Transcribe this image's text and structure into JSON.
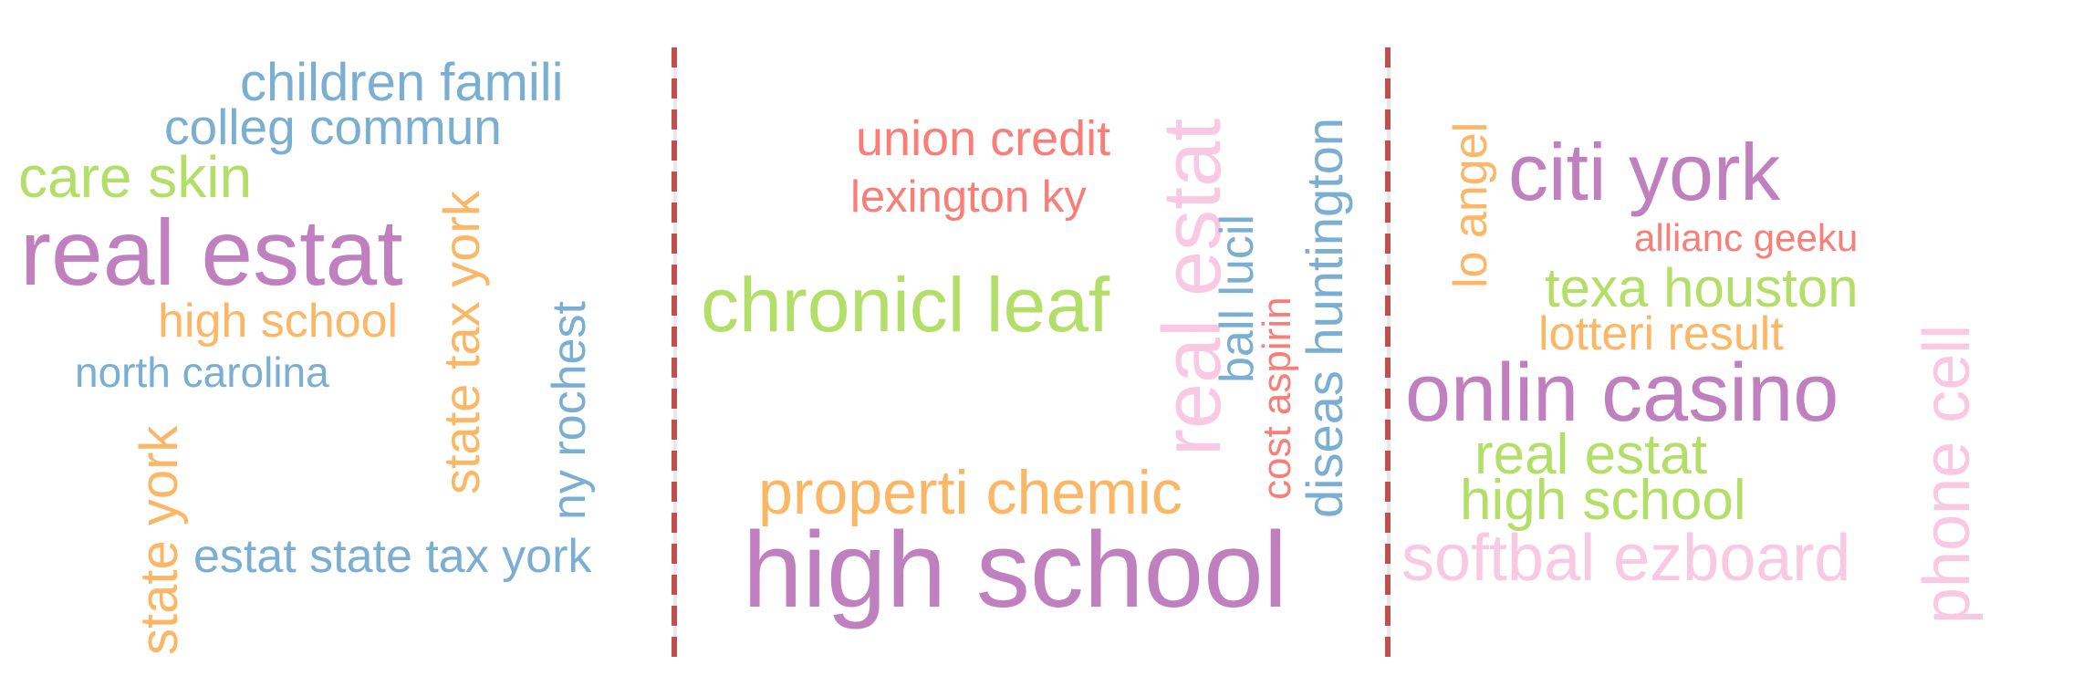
{
  "colors": {
    "blue": "#7aaed2",
    "green": "#b3df68",
    "purple": "#c080bf",
    "orange": "#fcb766",
    "red": "#f97e78",
    "pink": "#f9c9e3",
    "divider": "#c0504d"
  },
  "clouds": [
    {
      "words": [
        "children famili",
        "colleg commun",
        "care skin",
        "real estat",
        "high school",
        "north carolina",
        "state york",
        "state tax york",
        "ny rochest",
        "estat state tax york"
      ]
    },
    {
      "words": [
        "union credit",
        "lexington ky",
        "chronicl leaf",
        "properti chemic",
        "high school",
        "real estat",
        "ball lucil",
        "cost aspirin",
        "diseas huntington"
      ]
    },
    {
      "words": [
        "lo angel",
        "citi york",
        "allianc geeku",
        "texa houston",
        "lotteri result",
        "onlin casino",
        "real estat",
        "high school",
        "softbal ezboard",
        "phone cell"
      ]
    }
  ]
}
